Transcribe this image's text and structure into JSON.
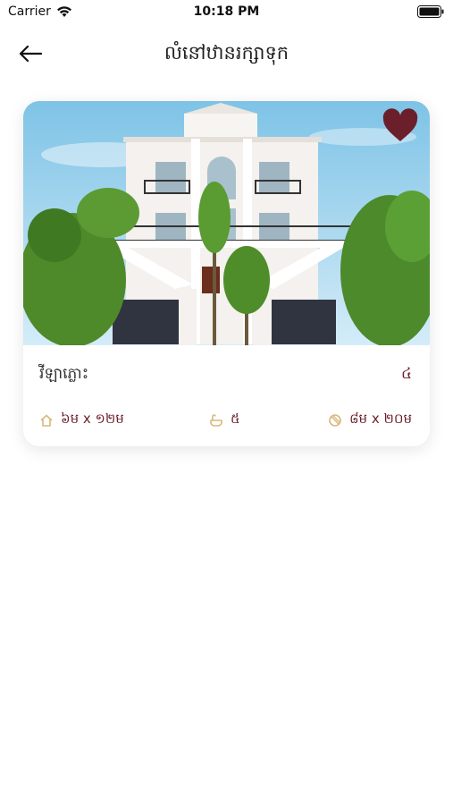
{
  "status_bar": {
    "carrier": "Carrier",
    "time": "10:18 PM"
  },
  "nav": {
    "title": "លំនៅឋានរក្សាទុក",
    "back_icon": "arrow-left-icon"
  },
  "property": {
    "favorited": true,
    "heart_color": "#6b1f2a",
    "label": "វីឡាភ្លោះ",
    "count": "៤",
    "floor_size": "៦ម x ១២ម",
    "bathrooms": "៥",
    "land_size": "៨ម x ២០ម",
    "icons": {
      "floor": "house-size-icon",
      "bath": "bathroom-icon",
      "land": "land-size-icon"
    }
  },
  "colors": {
    "accent": "#6b1f2a",
    "icon_gold": "#d9b77a"
  }
}
